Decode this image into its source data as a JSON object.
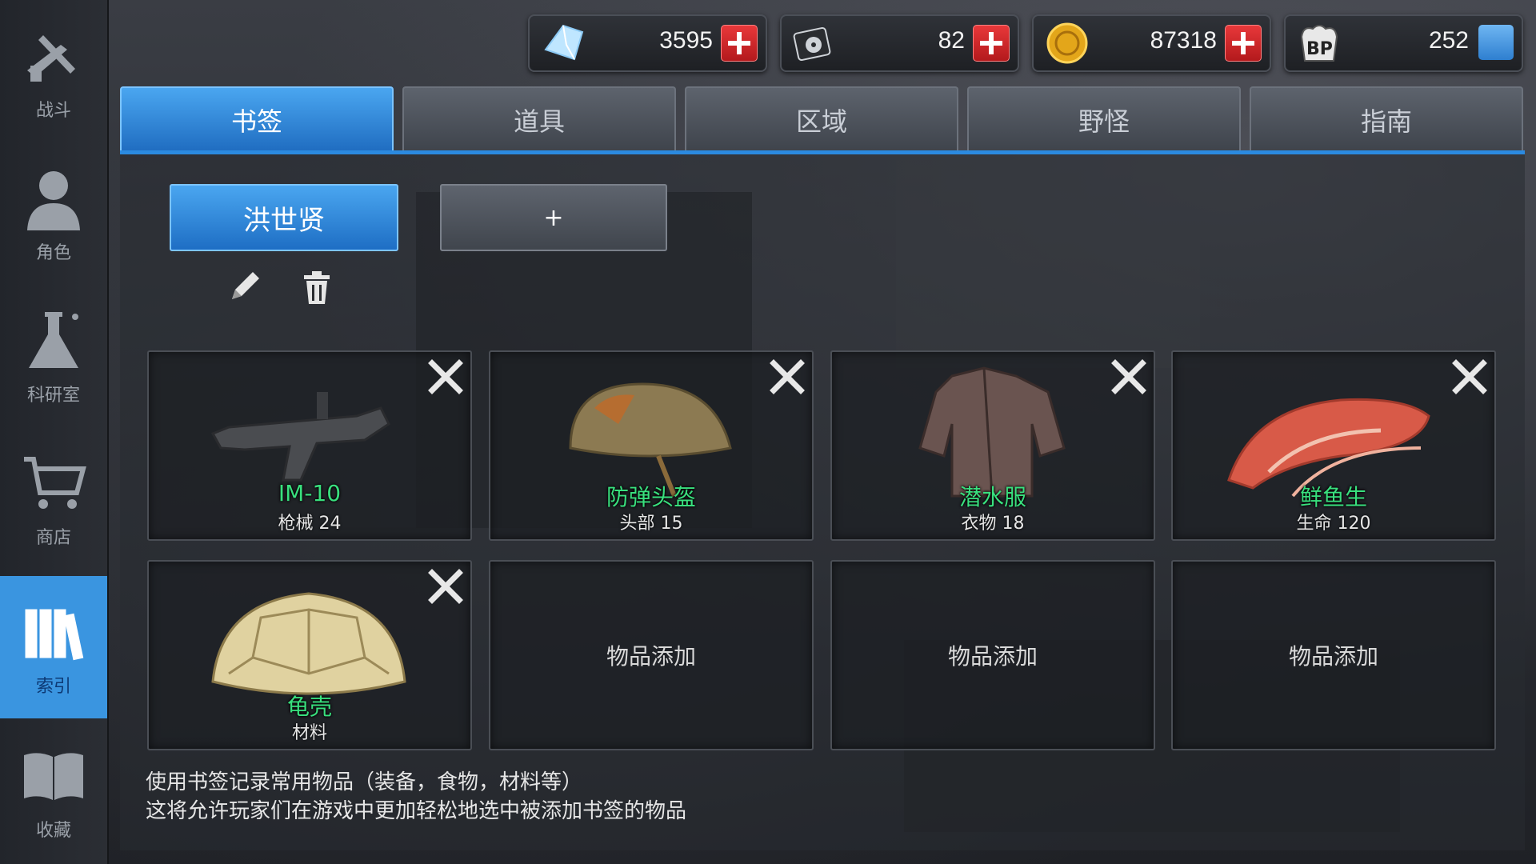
{
  "sidebar": {
    "items": [
      {
        "label": "战斗",
        "icon": "weapons-icon"
      },
      {
        "label": "角色",
        "icon": "character-icon"
      },
      {
        "label": "科研室",
        "icon": "flask-icon"
      },
      {
        "label": "商店",
        "icon": "cart-icon"
      },
      {
        "label": "索引",
        "icon": "books-icon",
        "active": true
      },
      {
        "label": "收藏",
        "icon": "open-book-icon"
      }
    ]
  },
  "currencies": [
    {
      "name": "diamond",
      "value": "3595",
      "icon": "diamond-icon"
    },
    {
      "name": "disc",
      "value": "82",
      "icon": "disc-icon"
    },
    {
      "name": "coin",
      "value": "87318",
      "icon": "coin-icon"
    },
    {
      "name": "bp",
      "value": "252",
      "icon": "bp-paw-icon"
    }
  ],
  "tabs": [
    "书签",
    "道具",
    "区域",
    "野怪",
    "指南"
  ],
  "bookmark": {
    "name": "洪世贤",
    "add_label": "+"
  },
  "items": [
    {
      "name": "IM-10",
      "sub": "枪械 24",
      "art": "smg-icon"
    },
    {
      "name": "防弹头盔",
      "sub": "头部 15",
      "art": "helmet-icon"
    },
    {
      "name": "潜水服",
      "sub": "衣物 18",
      "art": "jacket-icon"
    },
    {
      "name": "鲜鱼生",
      "sub": "生命 120",
      "art": "sashimi-icon"
    },
    {
      "name": "龟壳",
      "sub": "材料",
      "art": "turtle-shell-icon"
    }
  ],
  "empty_slot_label": "物品添加",
  "help": {
    "line1": "使用书签记录常用物品（装备，食物，材料等）",
    "line2": "这将允许玩家们在游戏中更加轻松地选中被添加书签的物品"
  },
  "colors": {
    "accent": "#3a95e0",
    "item_name": "#39e07e",
    "plus_red": "#d8282b"
  }
}
